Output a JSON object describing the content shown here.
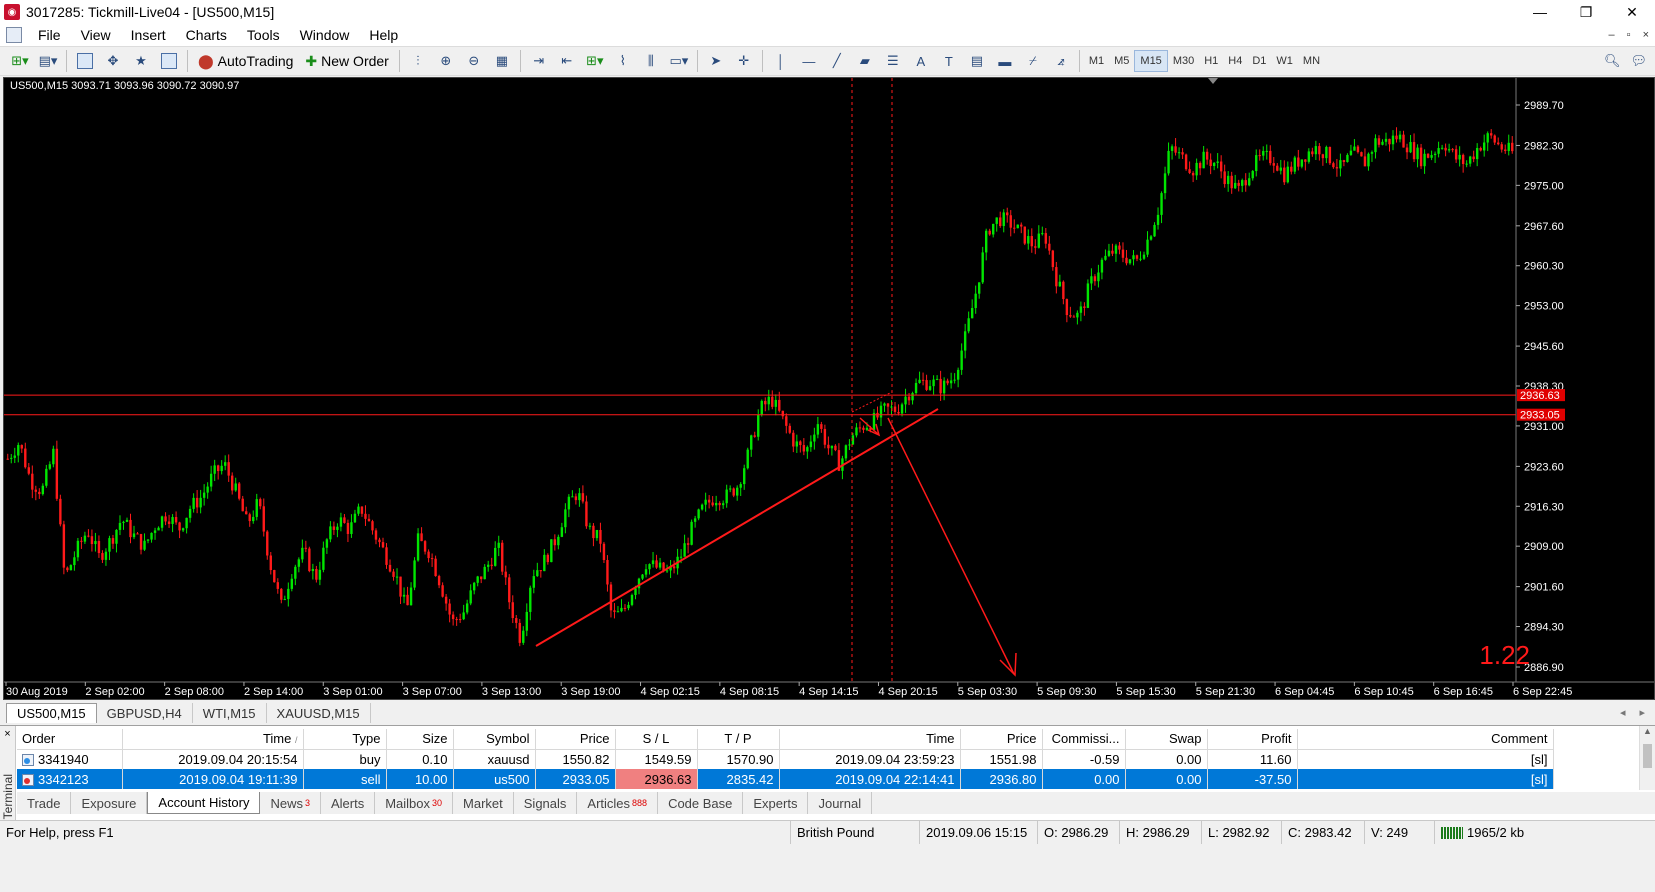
{
  "window": {
    "title": "3017285: Tickmill-Live04 - [US500,M15]",
    "min": "—",
    "restore": "❐",
    "close": "✕"
  },
  "menu": [
    "File",
    "View",
    "Insert",
    "Charts",
    "Tools",
    "Window",
    "Help"
  ],
  "toolbar": {
    "autotrading": "AutoTrading",
    "new_order": "New Order",
    "timeframes": [
      "M1",
      "M5",
      "M15",
      "M30",
      "H1",
      "H4",
      "D1",
      "W1",
      "MN"
    ],
    "active_timeframe": "M15"
  },
  "chart": {
    "header": "US500,M15  3093.71 3093.96 3090.72 3090.97",
    "corner_value": "1.22",
    "price_ticks": [
      "2989.70",
      "2982.30",
      "2975.00",
      "2967.60",
      "2960.30",
      "2953.00",
      "2945.60",
      "2938.30",
      "2931.00",
      "2923.60",
      "2916.30",
      "2909.00",
      "2901.60",
      "2894.30",
      "2886.90"
    ],
    "price_ticks_values": [
      2989.7,
      2982.3,
      2975.0,
      2967.6,
      2960.3,
      2953.0,
      2945.6,
      2938.3,
      2931.0,
      2923.6,
      2916.3,
      2909.0,
      2901.6,
      2894.3,
      2886.9
    ],
    "time_ticks": [
      "30 Aug 2019",
      "2 Sep 02:00",
      "2 Sep 08:00",
      "2 Sep 14:00",
      "3 Sep 01:00",
      "3 Sep 07:00",
      "3 Sep 13:00",
      "3 Sep 19:00",
      "4 Sep 02:15",
      "4 Sep 08:15",
      "4 Sep 14:15",
      "4 Sep 20:15",
      "5 Sep 03:30",
      "5 Sep 09:30",
      "5 Sep 15:30",
      "5 Sep 21:30",
      "6 Sep 04:45",
      "6 Sep 10:45",
      "6 Sep 16:45",
      "6 Sep 22:45"
    ],
    "sl_label": "2936.63",
    "entry_label": "2933.05",
    "sl_price": 2936.63,
    "entry_price": 2933.05,
    "colors": {
      "bull": "#00e600",
      "bear": "#ff1a1a",
      "bg": "#000000",
      "line": "#ff1a1a"
    },
    "price_path": [
      2925,
      2928,
      2921,
      2919,
      2926,
      2903,
      2908,
      2912,
      2907,
      2910,
      2914,
      2911,
      2909,
      2913,
      2915,
      2912,
      2916,
      2918,
      2922,
      2924,
      2919,
      2913,
      2917,
      2906,
      2898,
      2905,
      2908,
      2903,
      2910,
      2914,
      2912,
      2916,
      2912,
      2908,
      2904,
      2897,
      2910,
      2908,
      2902,
      2895,
      2897,
      2902,
      2905,
      2909,
      2899,
      2892,
      2904,
      2906,
      2910,
      2916,
      2919,
      2912,
      2910,
      2896,
      2897,
      2902,
      2906,
      2905,
      2904,
      2907,
      2912,
      2916,
      2918,
      2918,
      2920,
      2926,
      2934,
      2936,
      2932,
      2928,
      2926,
      2932,
      2927,
      2924,
      2929,
      2931,
      2932,
      2934,
      2934,
      2937,
      2939,
      2939,
      2938,
      2940,
      2947,
      2956,
      2967,
      2969,
      2968,
      2966,
      2964,
      2966,
      2958,
      2952,
      2951,
      2957,
      2961,
      2963,
      2962,
      2961,
      2965,
      2971,
      2982,
      2980,
      2978,
      2980,
      2979,
      2976,
      2974,
      2978,
      2980,
      2980,
      2977,
      2979,
      2981,
      2982,
      2980,
      2978,
      2981,
      2979,
      2983,
      2983,
      2984,
      2982,
      2980,
      2981,
      2983,
      2980,
      2979,
      2982,
      2984,
      2982,
      2981
    ]
  },
  "chart_tabs": [
    "US500,M15",
    "GBPUSD,H4",
    "WTI,M15",
    "XAUUSD,M15"
  ],
  "active_chart_tab": "US500,M15",
  "terminal": {
    "side_label": "Terminal",
    "close": "×",
    "columns": [
      "Order",
      "Time",
      "Type",
      "Size",
      "Symbol",
      "Price",
      "S / L",
      "T / P",
      "Time",
      "Price",
      "Commissi...",
      "Swap",
      "Profit",
      "Comment"
    ],
    "sort_indicator": "/",
    "rows": [
      {
        "order": "3341940",
        "open_time": "2019.09.04 20:15:54",
        "type": "buy",
        "size": "0.10",
        "symbol": "xauusd",
        "price": "1550.82",
        "sl": "1549.59",
        "tp": "1570.90",
        "close_time": "2019.09.04 23:59:23",
        "close_price": "1551.98",
        "commission": "-0.59",
        "swap": "0.00",
        "profit": "11.60",
        "comment": "[sl]"
      },
      {
        "order": "3342123",
        "open_time": "2019.09.04 19:11:39",
        "type": "sell",
        "size": "10.00",
        "symbol": "us500",
        "price": "2933.05",
        "sl": "2936.63",
        "tp": "2835.42",
        "close_time": "2019.09.04 22:14:41",
        "close_price": "2936.80",
        "commission": "0.00",
        "swap": "0.00",
        "profit": "-37.50",
        "comment": "[sl]"
      }
    ],
    "tabs": [
      {
        "label": "Trade",
        "badge": ""
      },
      {
        "label": "Exposure",
        "badge": ""
      },
      {
        "label": "Account History",
        "badge": ""
      },
      {
        "label": "News",
        "badge": "3"
      },
      {
        "label": "Alerts",
        "badge": ""
      },
      {
        "label": "Mailbox",
        "badge": "30"
      },
      {
        "label": "Market",
        "badge": ""
      },
      {
        "label": "Signals",
        "badge": ""
      },
      {
        "label": "Articles",
        "badge": "888"
      },
      {
        "label": "Code Base",
        "badge": ""
      },
      {
        "label": "Experts",
        "badge": ""
      },
      {
        "label": "Journal",
        "badge": ""
      }
    ],
    "active_tab": "Account History"
  },
  "status": {
    "help": "For Help, press F1",
    "profile": "British Pound",
    "datetime": "2019.09.06 15:15",
    "open": "O: 2986.29",
    "high": "H: 2986.29",
    "low": "L: 2982.92",
    "close": "C: 2983.42",
    "volume": "V: 249",
    "traffic": "1965/2 kb"
  }
}
